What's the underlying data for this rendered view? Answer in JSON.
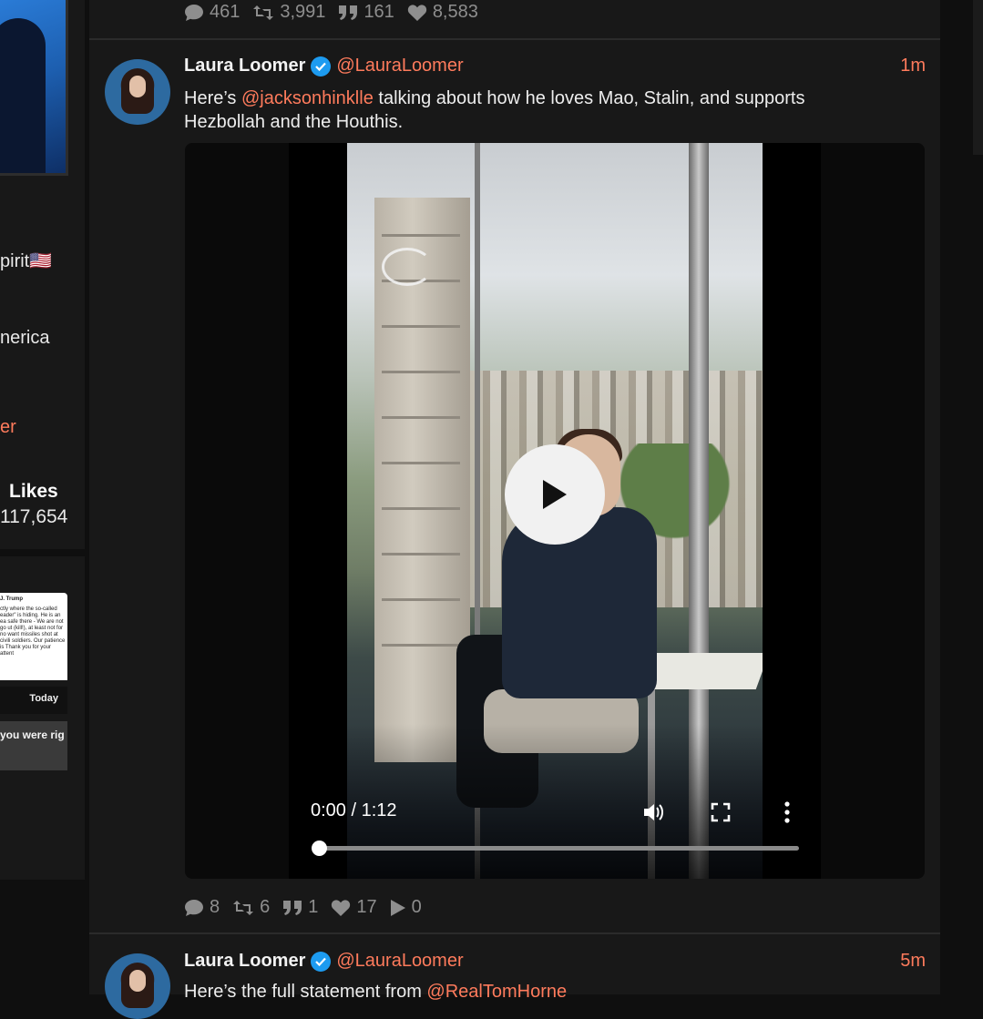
{
  "sidebar": {
    "bio_line_1": "pirit🇺🇸",
    "bio_line_2": "nerica",
    "bio_link": "er",
    "likes_label": "Likes",
    "likes_value": "117,654",
    "media": {
      "thumb_title": "J. Trump",
      "thumb_text": "ctly where the so-called eader\" is hiding. He is an ea safe there - We are not go ut (kill!), at least not for no want missiles shot at civili soldiers. Our patience is Thank you for your attent",
      "today_label": "Today",
      "grey_text": "you were rig"
    }
  },
  "previous_post": {
    "replies": "461",
    "reposts": "3,991",
    "quotes": "161",
    "likes": "8,583"
  },
  "post": {
    "author": "Laura Loomer",
    "handle": "@LauraLoomer",
    "time": "1m",
    "text_prefix": "Here’s ",
    "mention": "@jacksonhinklle",
    "text_suffix": " talking about how he loves Mao, Stalin, and supports Hezbollah and the Houthis.",
    "video": {
      "current_time": "0:00 / 1:12",
      "progress": 0
    },
    "stats": {
      "replies": "8",
      "reposts": "6",
      "quotes": "1",
      "likes": "17",
      "views": "0"
    }
  },
  "next_post": {
    "author": "Laura Loomer",
    "handle": "@LauraLoomer",
    "time": "5m",
    "text_prefix": "Here’s the full statement from ",
    "mention": "@RealTomHorne"
  },
  "icons": {
    "reply": "comment-icon",
    "repost": "repost-icon",
    "quote": "quote-icon",
    "like": "heart-icon",
    "views": "play-icon",
    "verified": "verified-badge-icon"
  },
  "colors": {
    "accent": "#ff7b5c",
    "verified": "#1d9bf0"
  }
}
